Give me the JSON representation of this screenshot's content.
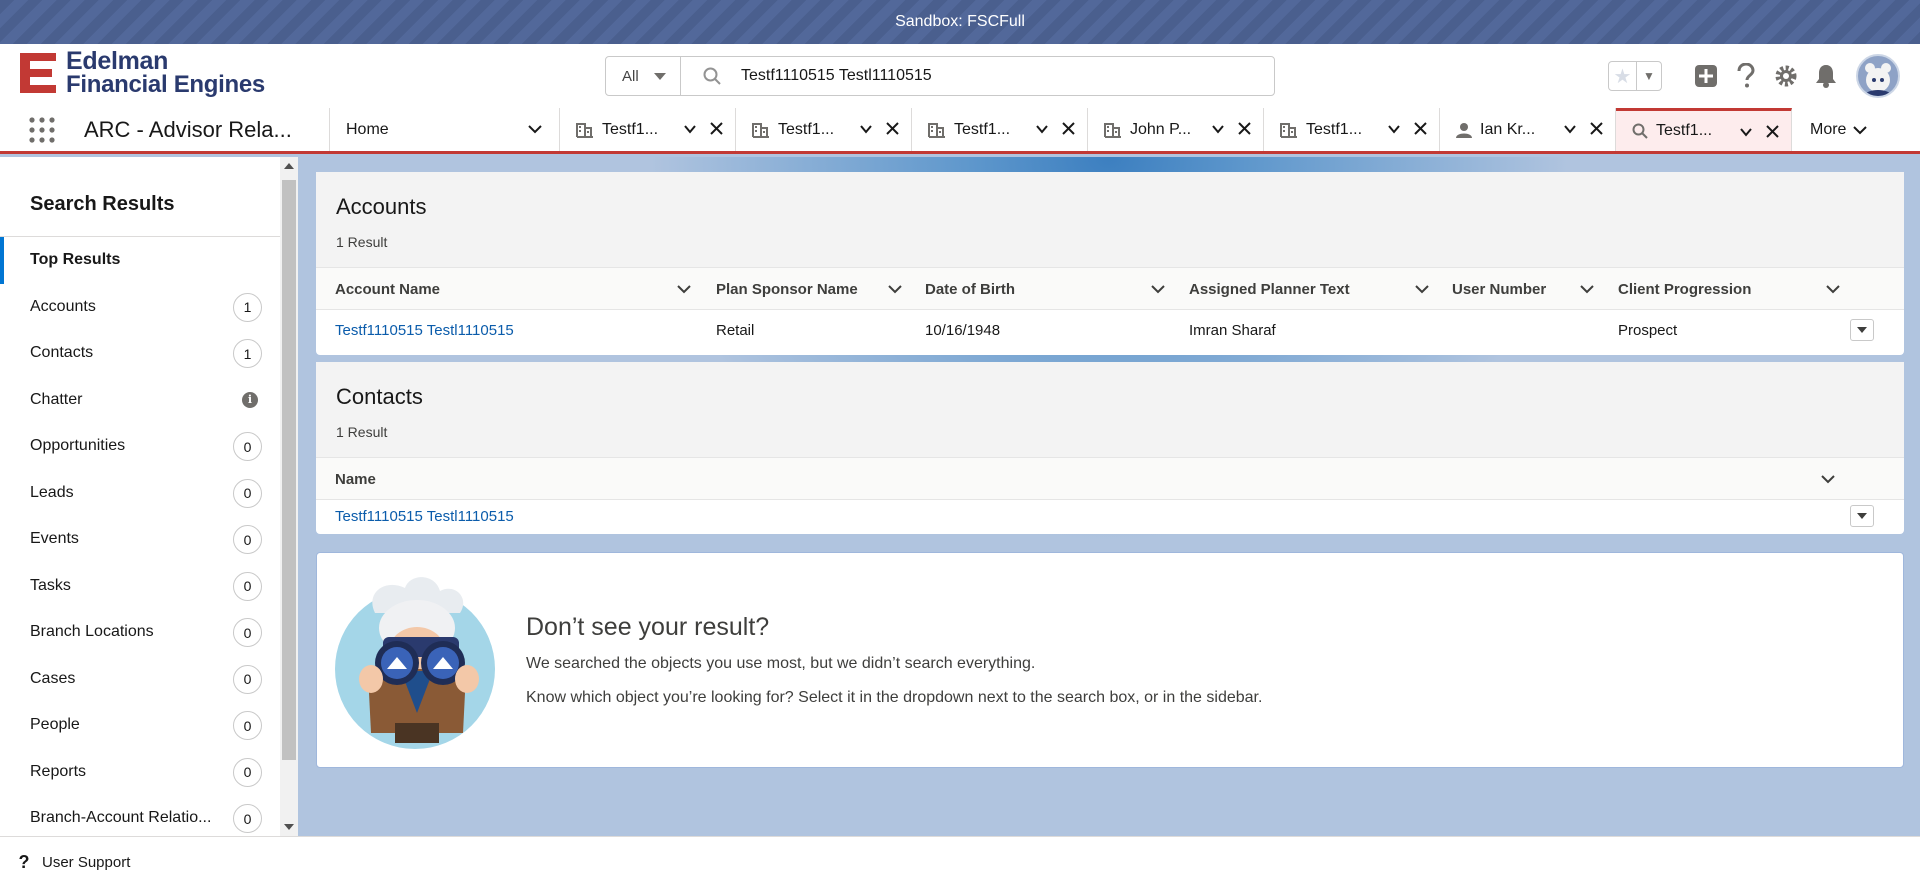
{
  "sandbox": {
    "label": "Sandbox: FSCFull"
  },
  "brand": {
    "line1": "Edelman",
    "line2": "Financial Engines"
  },
  "search": {
    "scope": "All",
    "query": "Testf1110515 Testl1110515"
  },
  "nav": {
    "app_name": "ARC - Advisor Rela...",
    "home_label": "Home",
    "tabs": [
      {
        "label": "Testf1...",
        "icon": "account-icon"
      },
      {
        "label": "Testf1...",
        "icon": "account-icon"
      },
      {
        "label": "Testf1...",
        "icon": "account-icon"
      },
      {
        "label": "John P...",
        "icon": "account-icon"
      },
      {
        "label": "Testf1...",
        "icon": "account-icon"
      },
      {
        "label": "Ian Kr...",
        "icon": "person-icon"
      },
      {
        "label": "Testf1...",
        "icon": "search-icon"
      }
    ],
    "more_label": "More"
  },
  "sidebar": {
    "title": "Search Results",
    "top_results": "Top Results",
    "items": [
      {
        "label": "Accounts",
        "count": "1"
      },
      {
        "label": "Contacts",
        "count": "1"
      },
      {
        "label": "Chatter",
        "count": ""
      },
      {
        "label": "Opportunities",
        "count": "0"
      },
      {
        "label": "Leads",
        "count": "0"
      },
      {
        "label": "Events",
        "count": "0"
      },
      {
        "label": "Tasks",
        "count": "0"
      },
      {
        "label": "Branch Locations",
        "count": "0"
      },
      {
        "label": "Cases",
        "count": "0"
      },
      {
        "label": "People",
        "count": "0"
      },
      {
        "label": "Reports",
        "count": "0"
      },
      {
        "label": "Branch-Account Relatio...",
        "count": "0"
      }
    ]
  },
  "accounts": {
    "title": "Accounts",
    "count_label": "1 Result",
    "columns": [
      "Account Name",
      "Plan Sponsor Name",
      "Date of Birth",
      "Assigned Planner Text",
      "User Number",
      "Client Progression"
    ],
    "rows": [
      [
        "Testf1110515 Testl1110515",
        "Retail",
        "10/16/1948",
        "Imran Sharaf",
        "",
        "Prospect"
      ]
    ]
  },
  "contacts": {
    "title": "Contacts",
    "count_label": "1 Result",
    "columns": [
      "Name"
    ],
    "rows": [
      [
        "Testf1110515 Testl1110515"
      ]
    ]
  },
  "empty": {
    "title": "Don’t see your result?",
    "line1": "We searched the objects you use most, but we didn’t search everything.",
    "line2": "Know which object you’re looking for? Select it in the dropdown next to the search box, or in the sidebar."
  },
  "utility": {
    "label": "User Support"
  },
  "colors": {
    "accent": "#0176d3",
    "nav_active": "#c23934",
    "link": "#0b5cab",
    "brand": "#c23934"
  }
}
